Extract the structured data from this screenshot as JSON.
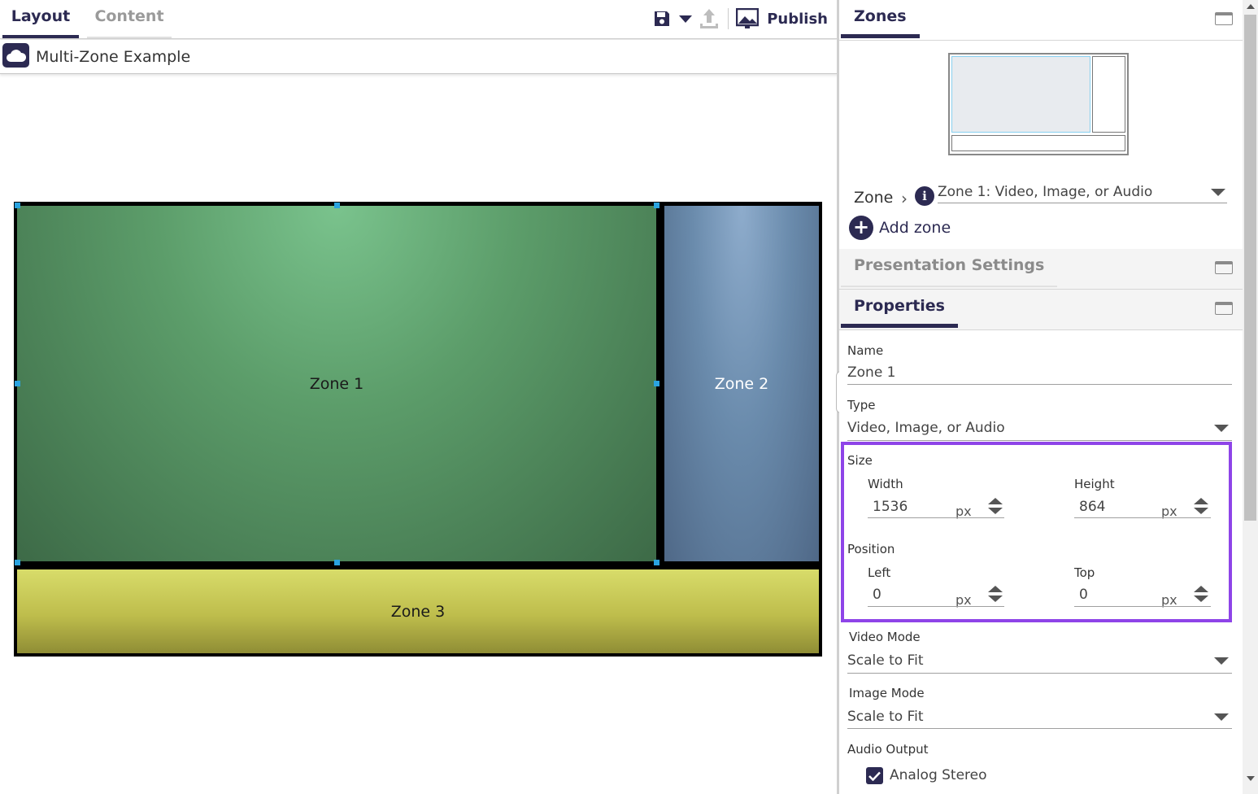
{
  "tabs": {
    "layout": "Layout",
    "content": "Content"
  },
  "toolbar": {
    "publish_label": "Publish"
  },
  "document": {
    "title": "Multi-Zone Example"
  },
  "canvas": {
    "zones": [
      {
        "label": "Zone 1",
        "color": "#5c9d6a"
      },
      {
        "label": "Zone 2",
        "color": "#6a8bac"
      },
      {
        "label": "Zone 3",
        "color": "#bebd4c"
      }
    ]
  },
  "zones_panel": {
    "title": "Zones",
    "zone_label": "Zone",
    "selected_zone": "Zone 1: Video, Image, or Audio",
    "add_zone": "Add zone"
  },
  "presentation_settings": {
    "title": "Presentation Settings"
  },
  "properties": {
    "title": "Properties",
    "name_label": "Name",
    "name_value": "Zone 1",
    "type_label": "Type",
    "type_value": "Video, Image, or Audio",
    "size_label": "Size",
    "width_label": "Width",
    "width_value": "1536",
    "height_label": "Height",
    "height_value": "864",
    "unit": "px",
    "position_label": "Position",
    "left_label": "Left",
    "left_value": "0",
    "top_label": "Top",
    "top_value": "0",
    "video_mode_label": "Video Mode",
    "video_mode_value": "Scale to Fit",
    "image_mode_label": "Image Mode",
    "image_mode_value": "Scale to Fit",
    "audio_output_label": "Audio Output",
    "analog_stereo": "Analog Stereo",
    "analog_stereo_checked": true
  },
  "colors": {
    "accent": "#2c2a52",
    "highlight": "#8e44e8",
    "handle": "#2aa3e0"
  }
}
